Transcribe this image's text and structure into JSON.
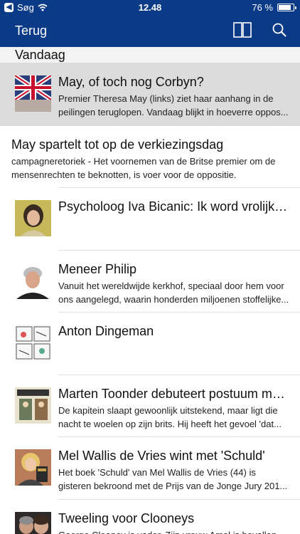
{
  "status": {
    "carrier": "Søg",
    "time": "12.48",
    "battery": "76 %",
    "battery_level": 0.76
  },
  "nav": {
    "back_label": "Terug",
    "icons": [
      "book-icon",
      "search-icon"
    ]
  },
  "section": {
    "title": "Vandaag"
  },
  "articles": [
    {
      "title": "May, of toch nog Corbyn?",
      "summary_line1": "Premier Theresa May (links) ziet haar aanhang in de",
      "summary_line2": "peilingen teruglopen. Vandaag blijkt in hoeverre oppos..."
    },
    {
      "title": "May spartelt tot op de verkiezingsdag",
      "summary_line1": "campagneretoriek - Het voornemen van de Britse premier om de",
      "summary_line2": "mensenrechten te beknotten, is voer voor de oppositie."
    },
    {
      "title": "Psycholoog Iva Bicanic: Ik word vrolijk v..."
    },
    {
      "title": "Meneer Philip",
      "summary_line1": "Vanuit het wereldwijde kerkhof, speciaal door hem voor",
      "summary_line2": "ons aangelegd, waarin honderden miljoenen stoffelijke..."
    },
    {
      "title": "Anton Dingeman"
    },
    {
      "title": "Marten Toonder debuteert postuum me...",
      "summary_line1": "De kapitein slaapt gewoonlijk uitstekend, maar ligt die",
      "summary_line2": "nacht te woelen op zijn brits. Hij heeft het gevoel 'dat..."
    },
    {
      "title": "Mel Wallis de Vries wint met 'Schuld'",
      "summary_line1": "Het boek 'Schuld' van Mel Wallis de Vries (44) is",
      "summary_line2": "gisteren bekroond met de Prijs van de Jonge Jury 201..."
    },
    {
      "title": "Tweeling voor Clooneys",
      "summary_line1": "George Clooney is vader. Zijn vrouw Amal is bevallen..."
    }
  ],
  "colors": {
    "nav_bg": "#0b3a87",
    "highlight_bg": "#dcdcdc",
    "section_bg": "#f3f3f3"
  }
}
